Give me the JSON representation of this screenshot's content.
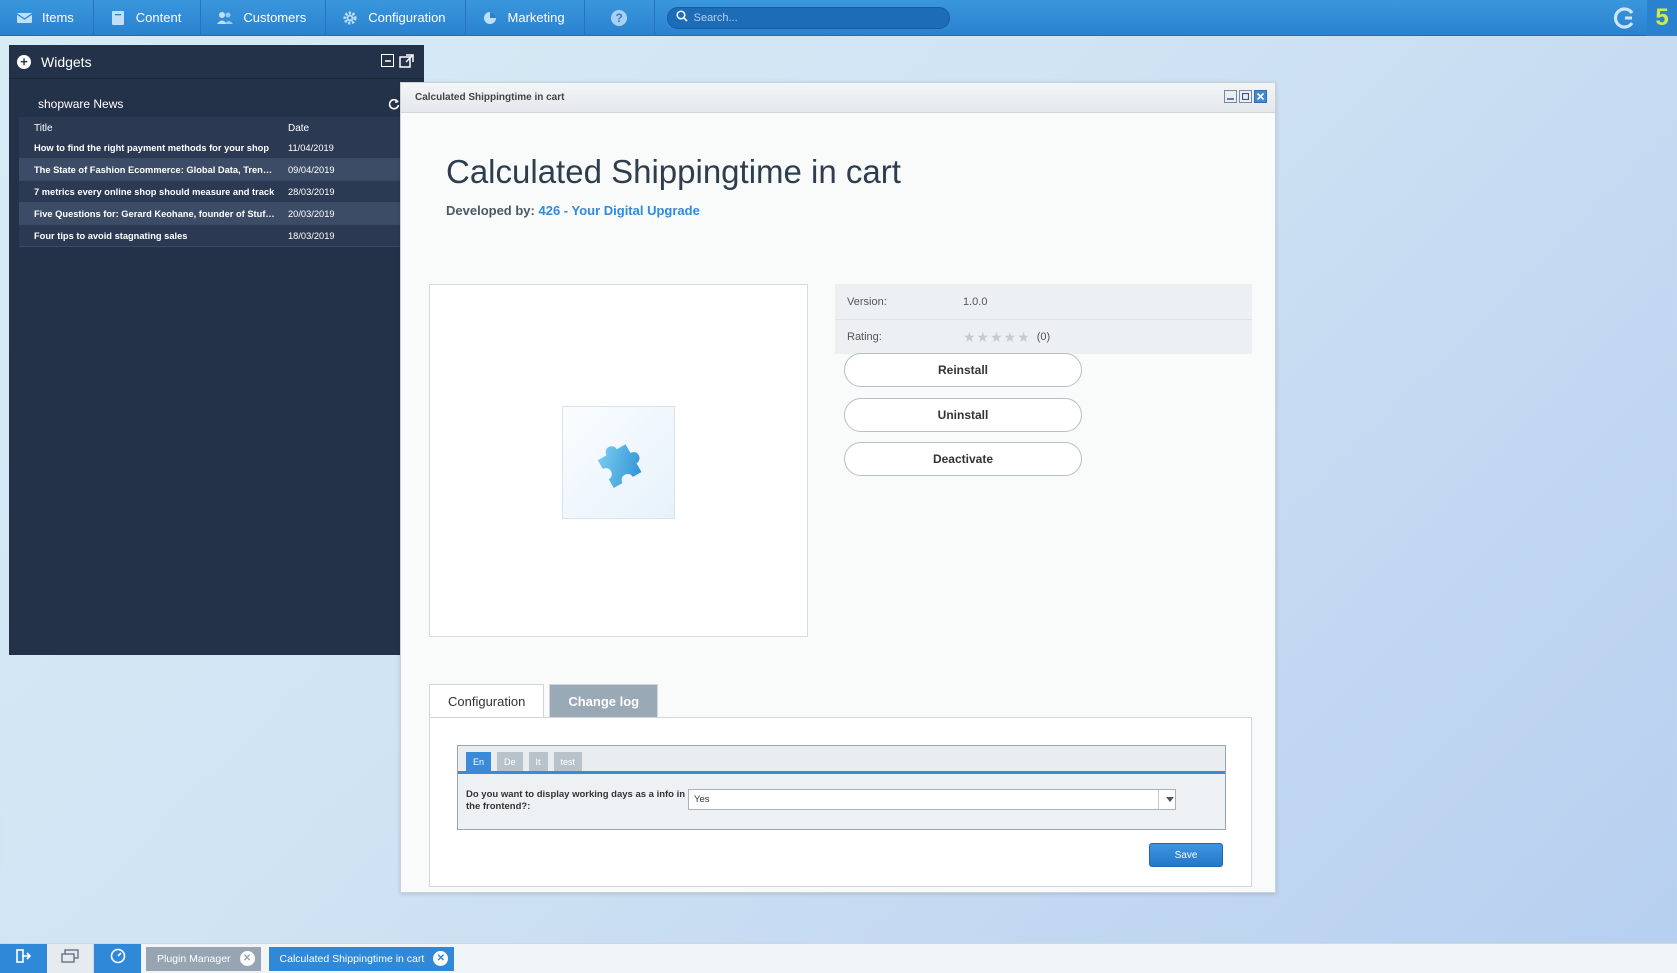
{
  "topbar": {
    "menu": [
      {
        "label": "Items",
        "icon": "items-icon"
      },
      {
        "label": "Content",
        "icon": "content-icon"
      },
      {
        "label": "Customers",
        "icon": "customers-icon"
      },
      {
        "label": "Configuration",
        "icon": "gear-icon"
      },
      {
        "label": "Marketing",
        "icon": "marketing-icon"
      }
    ],
    "help_label": "?",
    "search_placeholder": "Search...",
    "logo_5": "5"
  },
  "widgets": {
    "title": "Widgets",
    "news": {
      "title": "shopware News",
      "columns": [
        "Title",
        "Date"
      ],
      "rows": [
        {
          "title": "How to find the right payment methods for your shop",
          "date": "11/04/2019"
        },
        {
          "title": "The State of Fashion Ecommerce: Global Data, Trends and Insights",
          "date": "09/04/2019"
        },
        {
          "title": "7 metrics every online shop should measure and track",
          "date": "28/03/2019"
        },
        {
          "title": "Five Questions for: Gerard Keohane, founder of Stuff Ireland",
          "date": "20/03/2019"
        },
        {
          "title": "Four tips to avoid stagnating sales",
          "date": "18/03/2019"
        }
      ]
    }
  },
  "window": {
    "title": "Calculated Shippingtime in cart",
    "plugin_name": "Calculated Shippingtime in cart",
    "developer_label": "Developed by:",
    "developer_name": "426 - Your Digital Upgrade",
    "info": {
      "version_label": "Version:",
      "version_value": "1.0.0",
      "rating_label": "Rating:",
      "rating_stars": "★★★★★",
      "rating_value": 0,
      "rating_count": "(0)"
    },
    "buttons": {
      "reinstall": "Reinstall",
      "uninstall": "Uninstall",
      "deactivate": "Deactivate"
    },
    "tabs": [
      {
        "label": "Configuration",
        "active": true
      },
      {
        "label": "Change log",
        "active": false
      }
    ],
    "config": {
      "lang_tabs": [
        {
          "label": "En",
          "active": true
        },
        {
          "label": "De",
          "active": false
        },
        {
          "label": "It",
          "active": false
        },
        {
          "label": "test",
          "active": false
        }
      ],
      "field_label": "Do you want to display working days as a info in the frontend?:",
      "field_value": "Yes",
      "save_label": "Save"
    }
  },
  "taskbar": {
    "tasks": [
      {
        "label": "Plugin Manager",
        "active": false
      },
      {
        "label": "Calculated Shippingtime in cart",
        "active": true
      }
    ]
  },
  "colors": {
    "accent": "#2f88d8",
    "topbar": "#2a82cf",
    "widgets_bg": "#243249",
    "logo_5": "#cfe84a"
  }
}
